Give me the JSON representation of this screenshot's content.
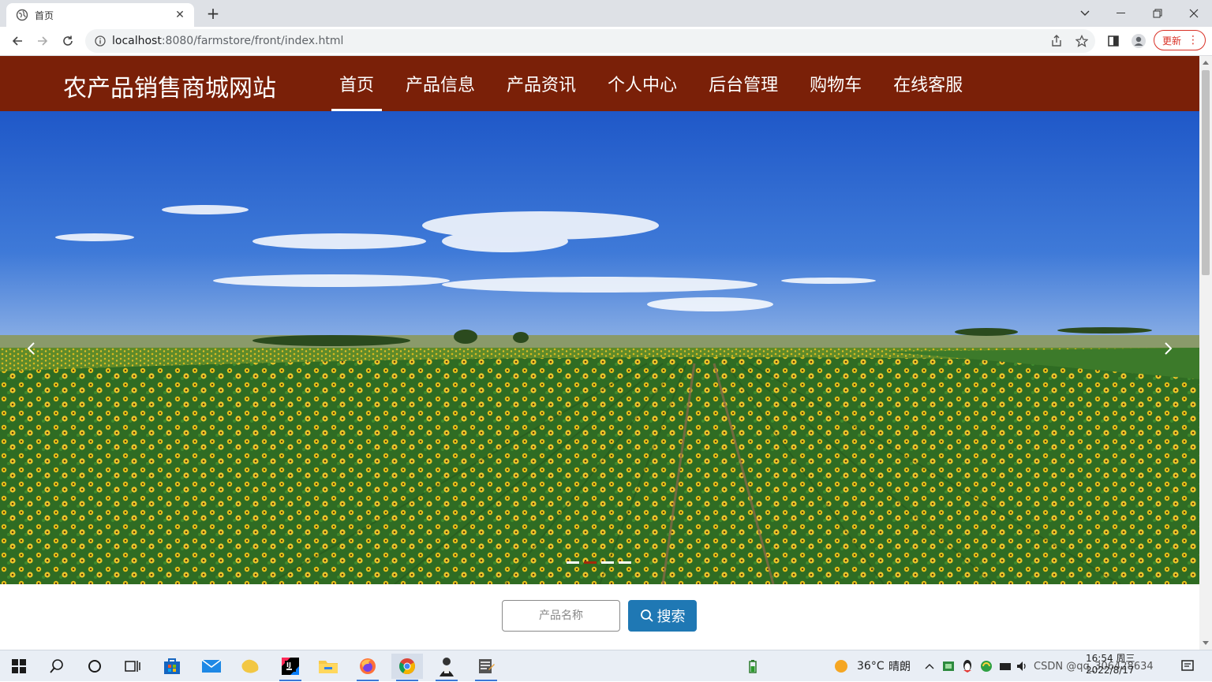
{
  "browser": {
    "tab_title": "首页",
    "url_host": "localhost",
    "url_rest": ":8080/farmstore/front/index.html",
    "update_label": "更新"
  },
  "site": {
    "logo": "农产品销售商城网站",
    "nav": [
      {
        "label": "首页",
        "active": true
      },
      {
        "label": "产品信息"
      },
      {
        "label": "产品资讯"
      },
      {
        "label": "个人中心"
      },
      {
        "label": "后台管理"
      },
      {
        "label": "购物车"
      },
      {
        "label": "在线客服"
      }
    ],
    "header_color": "#7a2008"
  },
  "carousel": {
    "slide_count": 4,
    "active_index": 1,
    "prev_icon": "chevron-left-icon",
    "next_icon": "chevron-right-icon"
  },
  "search": {
    "placeholder": "产品名称",
    "button_label": "搜索",
    "button_color": "#1f78b4"
  },
  "taskbar": {
    "weather_temp": "36°C",
    "weather_desc": "晴朗",
    "time": "16:54 周三",
    "date": "2022/8/17",
    "watermark": "CSDN @qq_306428634"
  }
}
